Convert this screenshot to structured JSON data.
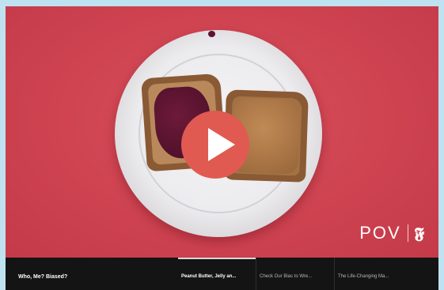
{
  "player": {
    "logo": {
      "brand_text": "POV",
      "publisher_mark": "𝕱"
    },
    "play_icon": "play-icon",
    "colors": {
      "background": "#cf4351",
      "play_button": "#e05a52",
      "bar": "#141414"
    }
  },
  "playlist": {
    "series_title": "Who, Me? Biased?",
    "episodes": [
      {
        "label": "Peanut Butter, Jelly an...",
        "active": true
      },
      {
        "label": "Check Our Bias to Wre...",
        "active": false
      },
      {
        "label": "The Life-Changing Ma...",
        "active": false
      }
    ]
  }
}
